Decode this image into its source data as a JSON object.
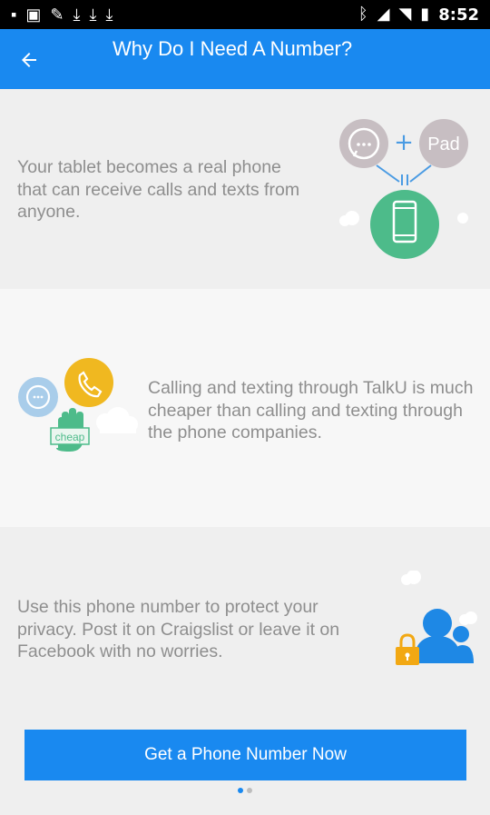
{
  "status_bar": {
    "time": "8:52",
    "left_icons": [
      "notification-icon",
      "photo-icon",
      "wrench-icon",
      "download-icon",
      "download-icon",
      "download-icon"
    ],
    "right_icons": [
      "bluetooth-icon",
      "signal-off-icon",
      "wifi-icon",
      "battery-icon"
    ]
  },
  "toolbar": {
    "title": "Why Do I Need A Number?",
    "background": "#1989f0"
  },
  "sections": [
    {
      "text": "Your tablet becomes a real phone that can receive calls and texts from anyone.",
      "image_label": "Pad"
    },
    {
      "text": "Calling and texting through TalkU is much cheaper than calling and texting through the phone companies.",
      "image_label": "cheap"
    },
    {
      "text": "Use this phone number to protect your privacy. Post it on Craigslist or leave it on Facebook with no worries."
    }
  ],
  "cta": {
    "label": "Get a Phone Number Now",
    "color": "#1989f0"
  }
}
